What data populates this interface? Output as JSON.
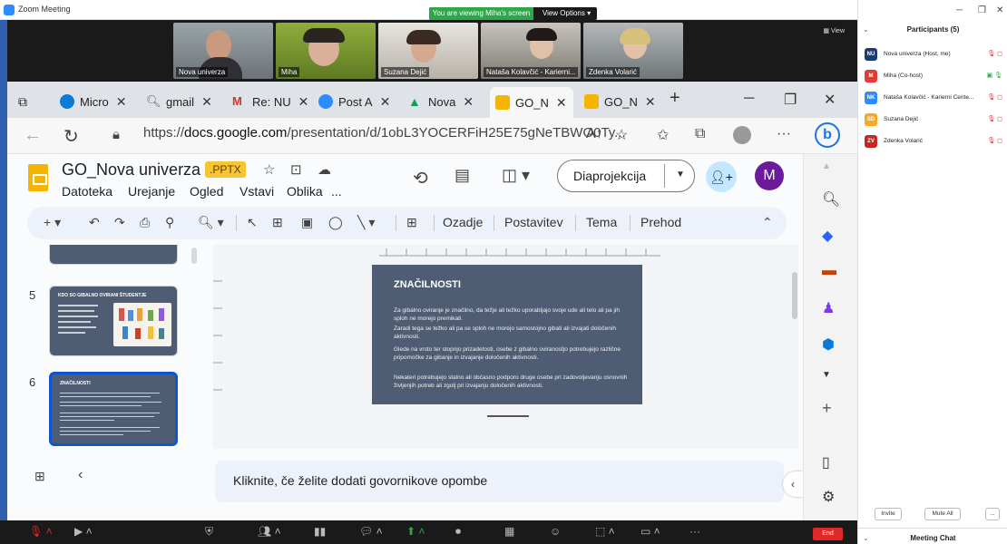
{
  "zoom": {
    "window_title": "Zoom Meeting",
    "viewing_banner": "You are viewing Miha's screen",
    "view_options": "View Options",
    "gallery_view_label": "View",
    "gallery": [
      {
        "name": "Nova univerza"
      },
      {
        "name": "Miha"
      },
      {
        "name": "Suzana Dejić"
      },
      {
        "name": "Nataša Kolavčić - Karierni..."
      },
      {
        "name": "Zdenka Volarić"
      }
    ],
    "end_label": "End",
    "bottom_icons": [
      "mic-muted-icon",
      "video-icon",
      "security-icon",
      "participants-icon",
      "polls-icon",
      "chat-icon",
      "share-screen-icon",
      "record-icon",
      "breakout-rooms-icon",
      "reactions-icon",
      "apps-icon",
      "whiteboards-icon",
      "more-icon"
    ]
  },
  "participants_panel": {
    "title": "Participants (5)",
    "people": [
      {
        "initials": "NU",
        "name": "Nova univerza (Host, me)",
        "color": "#1f3b73"
      },
      {
        "initials": "M",
        "name": "Miha (Co-host)",
        "color": "#e53935"
      },
      {
        "initials": "NK",
        "name": "Nataša Kolavčić - Karierni Cente...",
        "color": "#2d8cff"
      },
      {
        "initials": "SD",
        "name": "Suzana Dejić",
        "color": "#f9a825"
      },
      {
        "initials": "ZV",
        "name": "Zdenka Volarić",
        "color": "#c62828"
      }
    ],
    "invite_label": "Invite",
    "mute_all_label": "Mute All",
    "more_label": "...",
    "meeting_chat_label": "Meeting Chat"
  },
  "browser": {
    "tabs": [
      {
        "label": "Micro",
        "icon_color": "#0a7bd8"
      },
      {
        "label": "gmail",
        "icon_color": "#5f6368"
      },
      {
        "label": "Re: NU",
        "icon_color": "#d93025"
      },
      {
        "label": "Post A",
        "icon_color": "#2d8cff"
      },
      {
        "label": "Nova",
        "icon_color": "#0f9d58"
      },
      {
        "label": "GO_N",
        "icon_color": "#f4b400"
      },
      {
        "label": "GO_N",
        "icon_color": "#f4b400"
      }
    ],
    "url_prefix": "https://",
    "url_host": "docs.google.com",
    "url_path": "/presentation/d/1obL3YOCERFiH25E75gNeTBWO0Ty..."
  },
  "docs": {
    "title": "GO_Nova univerza",
    "badge": ".PPTX",
    "menus": [
      "Datoteka",
      "Urejanje",
      "Ogled",
      "Vstavi",
      "Oblika",
      "..."
    ],
    "slideshow_label": "Diaprojekcija",
    "avatar_letter": "M",
    "toolbar_text": [
      "Ozadje",
      "Postavitev",
      "Tema",
      "Prehod"
    ],
    "slides": [
      {
        "number": "5",
        "title": "KDO SO GIBALNO OVIRANI ŠTUDENTJE"
      },
      {
        "number": "6",
        "title": "ZNAČILNOSTI"
      }
    ],
    "current_slide": {
      "title": "ZNAČILNOSTI",
      "paragraphs": [
        "Za gibalno oviranje je značilno, da težje ali težko uporabljajo svoje ude ali telo ali pa jih sploh ne morejo premikati.",
        "Zaradi tega se težko ali pa se sploh ne morejo samostojno gibati ali izvajati določenih aktivnosti.",
        "Glede na vrsto ter stopnjo prizadetosti, osebe z gibalno oviranostjo potrebujejo različne pripomočke za gibanje in izvajanje določenih aktivnosti.",
        "Nekateri potrebujejo stalno ali občasno podporo druge osebe pri zadovoljevanju osnovnih življenjih potreb ali zgolj pri izvajanju določenih aktivnosti."
      ]
    },
    "notes_placeholder": "Kliknite, če želite dodati govornikove opombe"
  }
}
